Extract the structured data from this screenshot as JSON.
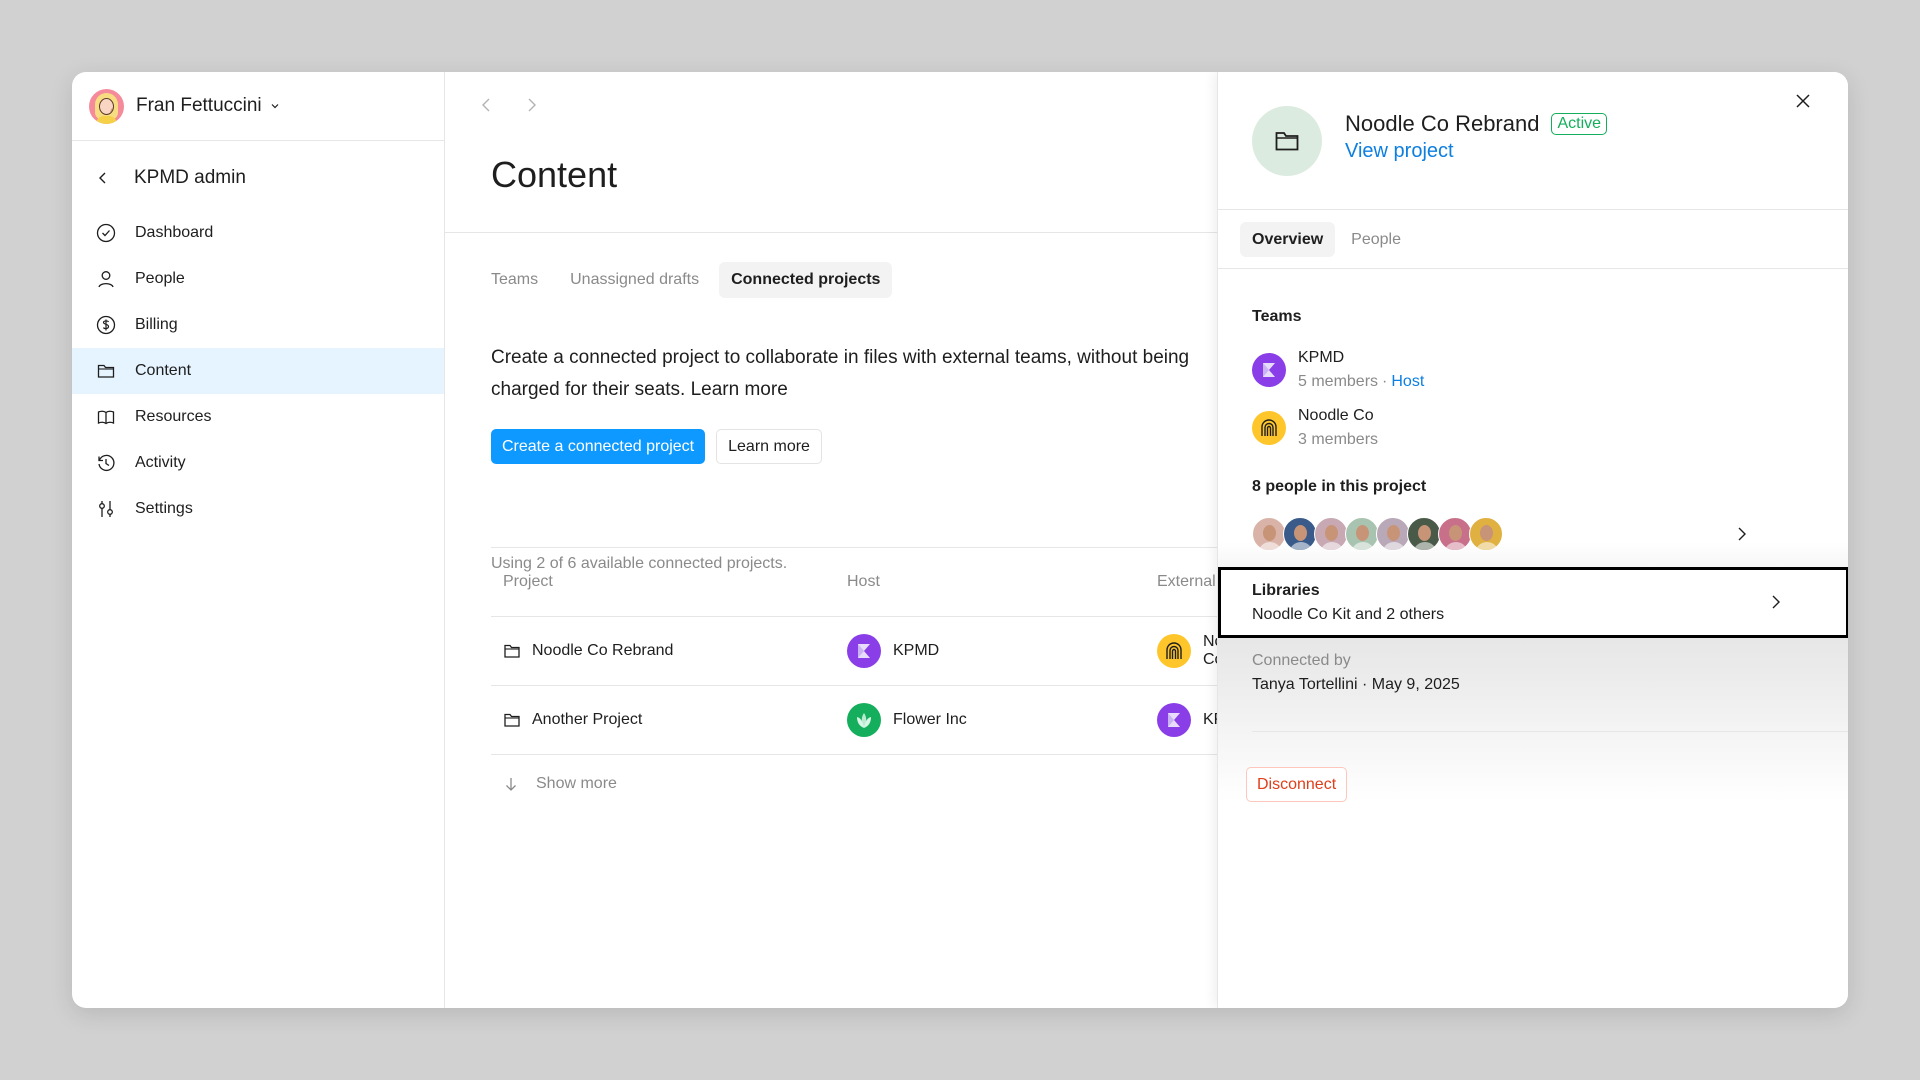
{
  "user": {
    "name": "Fran Fettuccini"
  },
  "sidebar": {
    "org_title": "KPMD admin",
    "items": [
      {
        "label": "Dashboard",
        "icon": "check-circle-icon",
        "active": false
      },
      {
        "label": "People",
        "icon": "person-icon",
        "active": false
      },
      {
        "label": "Billing",
        "icon": "dollar-circle-icon",
        "active": false
      },
      {
        "label": "Content",
        "icon": "folder-icon",
        "active": true
      },
      {
        "label": "Resources",
        "icon": "book-icon",
        "active": false
      },
      {
        "label": "Activity",
        "icon": "history-icon",
        "active": false
      },
      {
        "label": "Settings",
        "icon": "sliders-icon",
        "active": false
      }
    ]
  },
  "main": {
    "title": "Content",
    "tabs": [
      {
        "label": "Teams",
        "active": false
      },
      {
        "label": "Unassigned drafts",
        "active": false
      },
      {
        "label": "Connected projects",
        "active": true
      }
    ],
    "description": "Create a connected project to collaborate in files with external teams, without being charged for their seats. Learn more",
    "primary_button": "Create a connected project",
    "secondary_button": "Learn more",
    "usage_text": "Using 2 of 6 available connected projects.",
    "table": {
      "columns": [
        "Project",
        "Host",
        "External"
      ],
      "rows": [
        {
          "project": "Noodle Co Rebrand",
          "host": "KPMD",
          "host_logo": "kpmd",
          "external": "Noodle Co",
          "external_logo": "noodle"
        },
        {
          "project": "Another Project",
          "host": "Flower Inc",
          "host_logo": "flower",
          "external": "KPMD",
          "external_logo": "kpmd"
        }
      ]
    },
    "show_more": "Show more"
  },
  "panel": {
    "title": "Noodle Co Rebrand",
    "status": "Active",
    "view_link": "View project",
    "tabs": [
      {
        "label": "Overview",
        "active": true
      },
      {
        "label": "People",
        "active": false
      }
    ],
    "teams_heading": "Teams",
    "teams": [
      {
        "name": "KPMD",
        "members": "5 members",
        "role": "Host",
        "logo": "kpmd"
      },
      {
        "name": "Noodle Co",
        "members": "3 members",
        "role": "",
        "logo": "noodle"
      }
    ],
    "people_heading": "8 people in this project",
    "people_count": 8,
    "libraries_title": "Libraries",
    "libraries_value": "Noodle Co Kit and 2 others",
    "connected_by_label": "Connected by",
    "connected_by_value": "Tanya Tortellini · May 9, 2025",
    "disconnect_label": "Disconnect"
  },
  "colors": {
    "accent": "#0d99ff",
    "link": "#0d7fe0",
    "active_badge": "#14ae5c",
    "danger": "#e03e1a",
    "kpmd_logo": "#8a3ee8",
    "noodle_logo": "#ffc62b",
    "flower_logo": "#14ae5c",
    "sidebar_active_bg": "#e5f4ff"
  }
}
